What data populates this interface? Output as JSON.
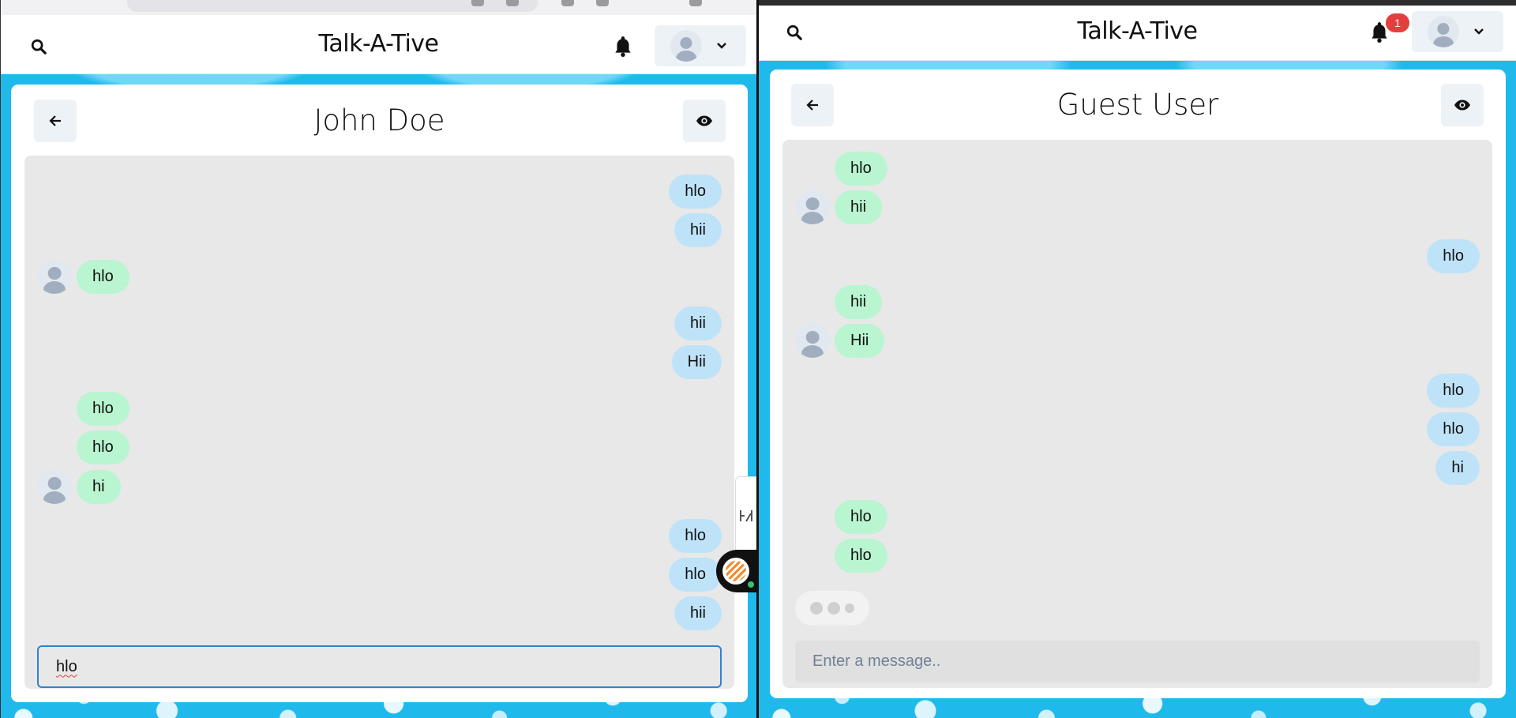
{
  "left": {
    "app_title": "Talk-A-Tive",
    "chat_title": "John Doe",
    "messages": [
      {
        "text": "hlo",
        "side": "right"
      },
      {
        "text": "hii",
        "side": "right"
      },
      {
        "text": "hlo",
        "side": "left",
        "avatar": true
      },
      {
        "text": "hii",
        "side": "right"
      },
      {
        "text": "Hii",
        "side": "right"
      },
      {
        "text": "hlo",
        "side": "left"
      },
      {
        "text": "hlo",
        "side": "left"
      },
      {
        "text": "hi",
        "side": "left",
        "avatar": true
      },
      {
        "text": "hlo",
        "side": "right"
      },
      {
        "text": "hlo",
        "side": "right"
      },
      {
        "text": "hii",
        "side": "right"
      }
    ],
    "input_value": "hlo"
  },
  "right": {
    "app_title": "Talk-A-Tive",
    "notification_count": "1",
    "chat_title": "Guest User",
    "messages": [
      {
        "text": "hlo",
        "side": "left"
      },
      {
        "text": "hii",
        "side": "left",
        "avatar": true
      },
      {
        "text": "hlo",
        "side": "right"
      },
      {
        "text": "hii",
        "side": "left"
      },
      {
        "text": "Hii",
        "side": "left",
        "avatar": true
      },
      {
        "text": "hlo",
        "side": "right"
      },
      {
        "text": "hlo",
        "side": "right"
      },
      {
        "text": "hi",
        "side": "right"
      },
      {
        "text": "hlo",
        "side": "left"
      },
      {
        "text": "hlo",
        "side": "left"
      }
    ],
    "input_placeholder": "Enter a message.."
  },
  "icons": {
    "search": "search-icon",
    "bell": "bell-icon",
    "back": "arrow-left-icon",
    "eye": "eye-icon",
    "chevron": "chevron-down-icon",
    "avatar": "user-avatar-icon"
  },
  "colors": {
    "background": "#1fb9ec",
    "sent_bubble": "#bee3f8",
    "received_bubble": "#b9f5d0",
    "chat_area": "#e8e8e8",
    "focus_border": "#3182ce",
    "badge": "#e53e3e"
  }
}
